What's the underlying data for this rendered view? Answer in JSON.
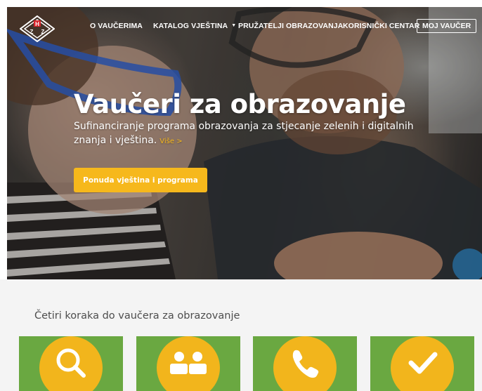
{
  "header": {
    "logo_letters": "HZZ",
    "nav": [
      {
        "label": "O VAUČERIMA"
      },
      {
        "label": "KATALOG VJEŠTINA",
        "has_dropdown": true
      },
      {
        "label": "PRUŽATELJI OBRAZOVANJA"
      },
      {
        "label": "KORISNIČKI CENTAR"
      }
    ],
    "account_button": "MOJ VAUČER"
  },
  "hero": {
    "title": "Vaučeri za obrazovanje",
    "subtitle": "Sufinanciranje programa obrazovanja za stjecanje zelenih i digitalnih znanja i vještina.",
    "more_link": "Više >",
    "cta_label": "Ponuda vještina i programa"
  },
  "steps": {
    "title": "Četiri koraka do vaučera za obrazovanje",
    "items": [
      {
        "icon": "search-icon"
      },
      {
        "icon": "users-icon"
      },
      {
        "icon": "phone-icon"
      },
      {
        "icon": "checkmark-icon"
      }
    ]
  },
  "colors": {
    "accent_yellow": "#f6b81c",
    "step_green": "#6aa841",
    "logo_red": "#d8232a",
    "section_background": "#f4f4f4"
  }
}
